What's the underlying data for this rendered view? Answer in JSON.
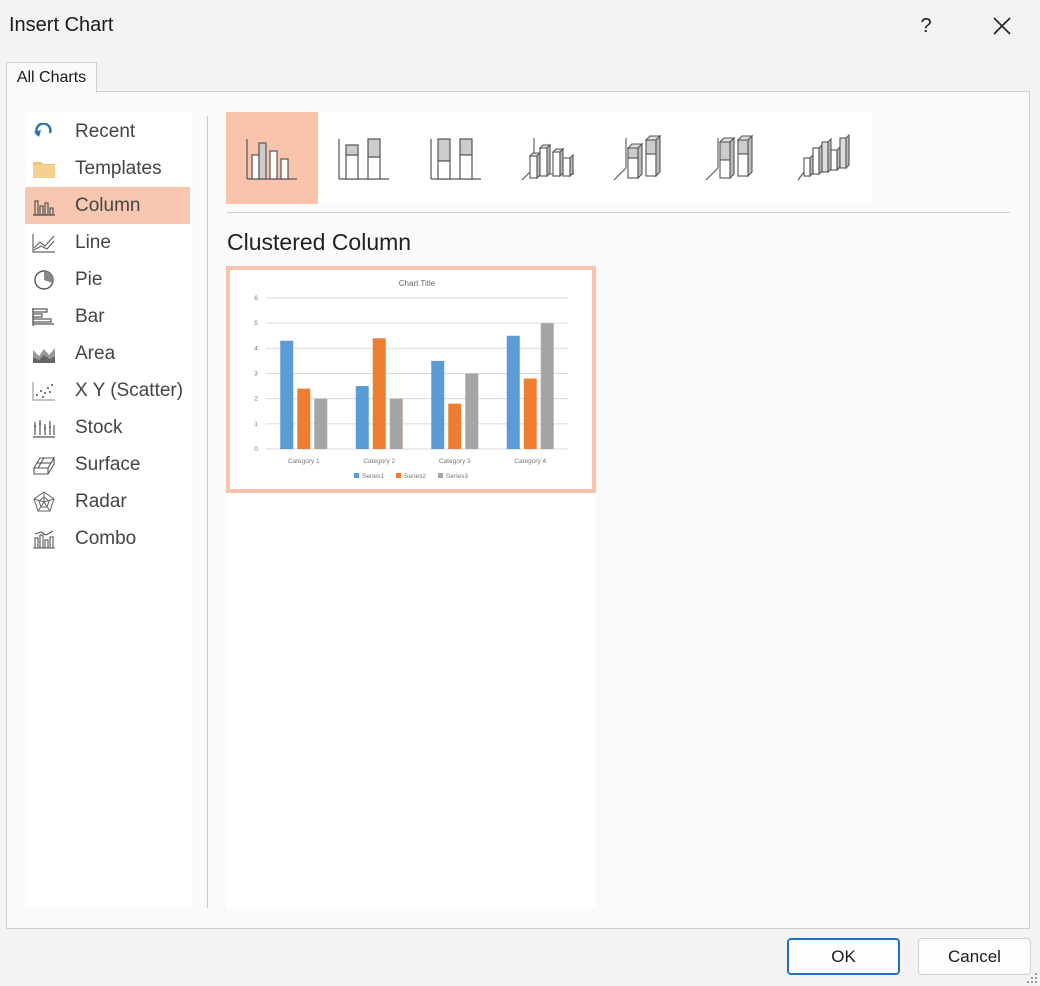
{
  "window": {
    "title": "Insert Chart",
    "help_label": "?",
    "close_label": "close"
  },
  "tabs": [
    {
      "label": "All Charts"
    }
  ],
  "categories": [
    {
      "label": "Recent",
      "icon": "recent-icon"
    },
    {
      "label": "Templates",
      "icon": "folder-icon"
    },
    {
      "label": "Column",
      "icon": "column-chart-icon",
      "selected": true
    },
    {
      "label": "Line",
      "icon": "line-chart-icon"
    },
    {
      "label": "Pie",
      "icon": "pie-chart-icon"
    },
    {
      "label": "Bar",
      "icon": "bar-chart-icon"
    },
    {
      "label": "Area",
      "icon": "area-chart-icon"
    },
    {
      "label": "X Y (Scatter)",
      "icon": "scatter-chart-icon"
    },
    {
      "label": "Stock",
      "icon": "stock-chart-icon"
    },
    {
      "label": "Surface",
      "icon": "surface-chart-icon"
    },
    {
      "label": "Radar",
      "icon": "radar-chart-icon"
    },
    {
      "label": "Combo",
      "icon": "combo-chart-icon"
    }
  ],
  "subtypes": [
    {
      "icon": "clustered-column-icon",
      "selected": true
    },
    {
      "icon": "stacked-column-icon"
    },
    {
      "icon": "100-stacked-column-icon"
    },
    {
      "icon": "3d-clustered-column-icon"
    },
    {
      "icon": "3d-stacked-column-icon"
    },
    {
      "icon": "3d-100-stacked-column-icon"
    },
    {
      "icon": "3d-column-icon"
    }
  ],
  "selected_subtype_title": "Clustered Column",
  "chart_data": {
    "type": "bar",
    "title": "Chart Title",
    "categories": [
      "Category 1",
      "Category 2",
      "Category 3",
      "Category 4"
    ],
    "series": [
      {
        "name": "Series1",
        "values": [
          4.3,
          2.5,
          3.5,
          4.5
        ],
        "color": "#5b9bd5"
      },
      {
        "name": "Series2",
        "values": [
          2.4,
          4.4,
          1.8,
          2.8
        ],
        "color": "#ed7d31"
      },
      {
        "name": "Series3",
        "values": [
          2,
          2,
          3,
          5
        ],
        "color": "#a5a5a5"
      }
    ],
    "ylim": [
      0,
      6
    ],
    "yticks": [
      "0",
      "1",
      "2",
      "3",
      "4",
      "5",
      "6"
    ],
    "grid": true,
    "legend": "bottom"
  },
  "buttons": {
    "ok": "OK",
    "cancel": "Cancel"
  }
}
